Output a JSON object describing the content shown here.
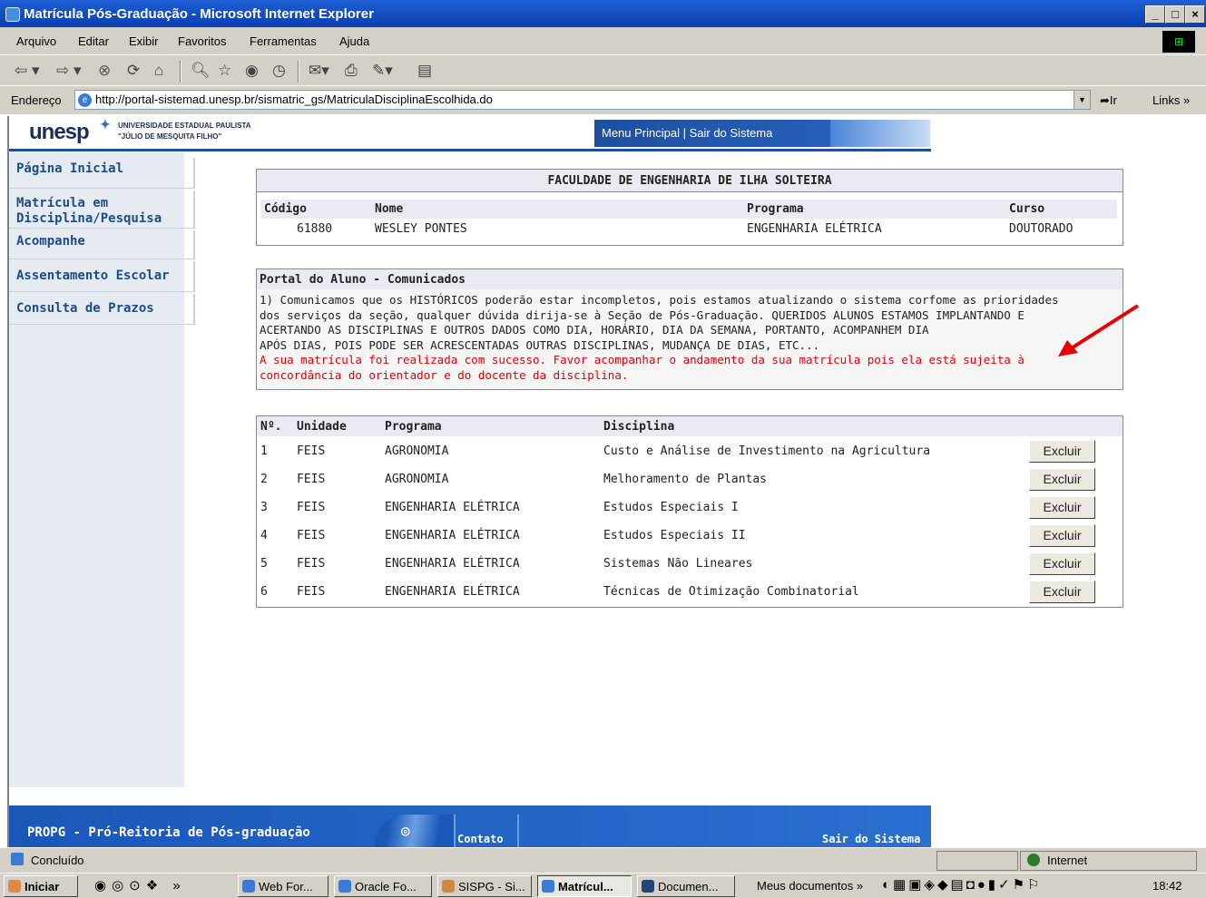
{
  "window": {
    "title": "Matrícula Pós-Graduação - Microsoft Internet Explorer",
    "buttons": [
      "_",
      "□",
      "×"
    ]
  },
  "menu": [
    "Arquivo",
    "Editar",
    "Exibir",
    "Favoritos",
    "Ferramentas",
    "Ajuda"
  ],
  "address": {
    "label": "Endereço",
    "url": "http://portal-sistemad.unesp.br/sismatric_gs/MatriculaDisciplinaEscolhida.do",
    "go": "Ir",
    "links": "Links"
  },
  "banner": {
    "logo": "unesp",
    "univ": "UNIVERSIDADE ESTADUAL PAULISTA",
    "univ2": "\"JÚLIO DE MESQUITA FILHO\"",
    "menu": "Menu Principal | Sair do Sistema"
  },
  "sidebar": [
    "Página Inicial",
    "Matrícula em Disciplina/Pesquisa",
    "Acompanhe",
    "Assentamento Escolar",
    "Consulta de Prazos"
  ],
  "faculty": {
    "title": "FACULDADE DE ENGENHARIA DE ILHA SOLTEIRA",
    "headers": [
      "Código",
      "Nome",
      "Programa",
      "Curso"
    ],
    "values": [
      "61880",
      "WESLEY PONTES",
      "ENGENHARIA ELÉTRICA",
      "DOUTORADO"
    ]
  },
  "notice": {
    "title": "Portal do Aluno - Comunicados",
    "lines": [
      "1) Comunicamos que os HISTÓRICOS poderão estar incompletos, pois estamos atualizando o sistema corfome as prioridades",
      "dos serviços da seção, qualquer dúvida dirija-se à Seção de Pós-Graduação. QUERIDOS ALUNOS ESTAMOS IMPLANTANDO E",
      "ACERTANDO AS DISCIPLINAS E OUTROS DADOS COMO DIA, HORÁRIO, DIA DA SEMANA, PORTANTO, ACOMPANHEM DIA",
      "APÓS DIAS, POIS PODE SER ACRESCENTADAS OUTRAS DISCIPLINAS, MUDANÇA DE DIAS, ETC..."
    ],
    "success": [
      "A sua matrícula foi realizada com sucesso. Favor acompanhar o andamento da sua matrícula pois ela está sujeita à",
      "concordância do orientador e do docente da disciplina."
    ]
  },
  "disciplines": {
    "headers": [
      "Nº.",
      "Unidade",
      "Programa",
      "Disciplina"
    ],
    "button_label": "Excluir",
    "rows": [
      [
        "1",
        "FEIS",
        "AGRONOMIA",
        "Custo e Análise de Investimento na Agricultura"
      ],
      [
        "2",
        "FEIS",
        "AGRONOMIA",
        "Melhoramento de Plantas"
      ],
      [
        "3",
        "FEIS",
        "ENGENHARIA ELÉTRICA",
        "Estudos Especiais I"
      ],
      [
        "4",
        "FEIS",
        "ENGENHARIA ELÉTRICA",
        "Estudos Especiais II"
      ],
      [
        "5",
        "FEIS",
        "ENGENHARIA ELÉTRICA",
        "Sistemas Não Lineares"
      ],
      [
        "6",
        "FEIS",
        "ENGENHARIA ELÉTRICA",
        "Técnicas de Otimização Combinatorial"
      ]
    ]
  },
  "footer": {
    "brand": "PROPG - Pró-Reitoria de Pós-graduação",
    "contato": "Contato",
    "sair": "Sair do Sistema"
  },
  "status": {
    "text": "Concluído",
    "zone": "Internet"
  },
  "taskbar": {
    "start": "Iniciar",
    "items": [
      "Web For...",
      "Oracle Fo...",
      "SISPG - Si...",
      "Matrícul...",
      "Documen..."
    ],
    "docs": "Meus documentos",
    "clock": "18:42"
  },
  "colors": {
    "accent": "#1d4fa0",
    "link": "#1c4c8c",
    "success": "#e00000",
    "arrow": "#e60000"
  }
}
